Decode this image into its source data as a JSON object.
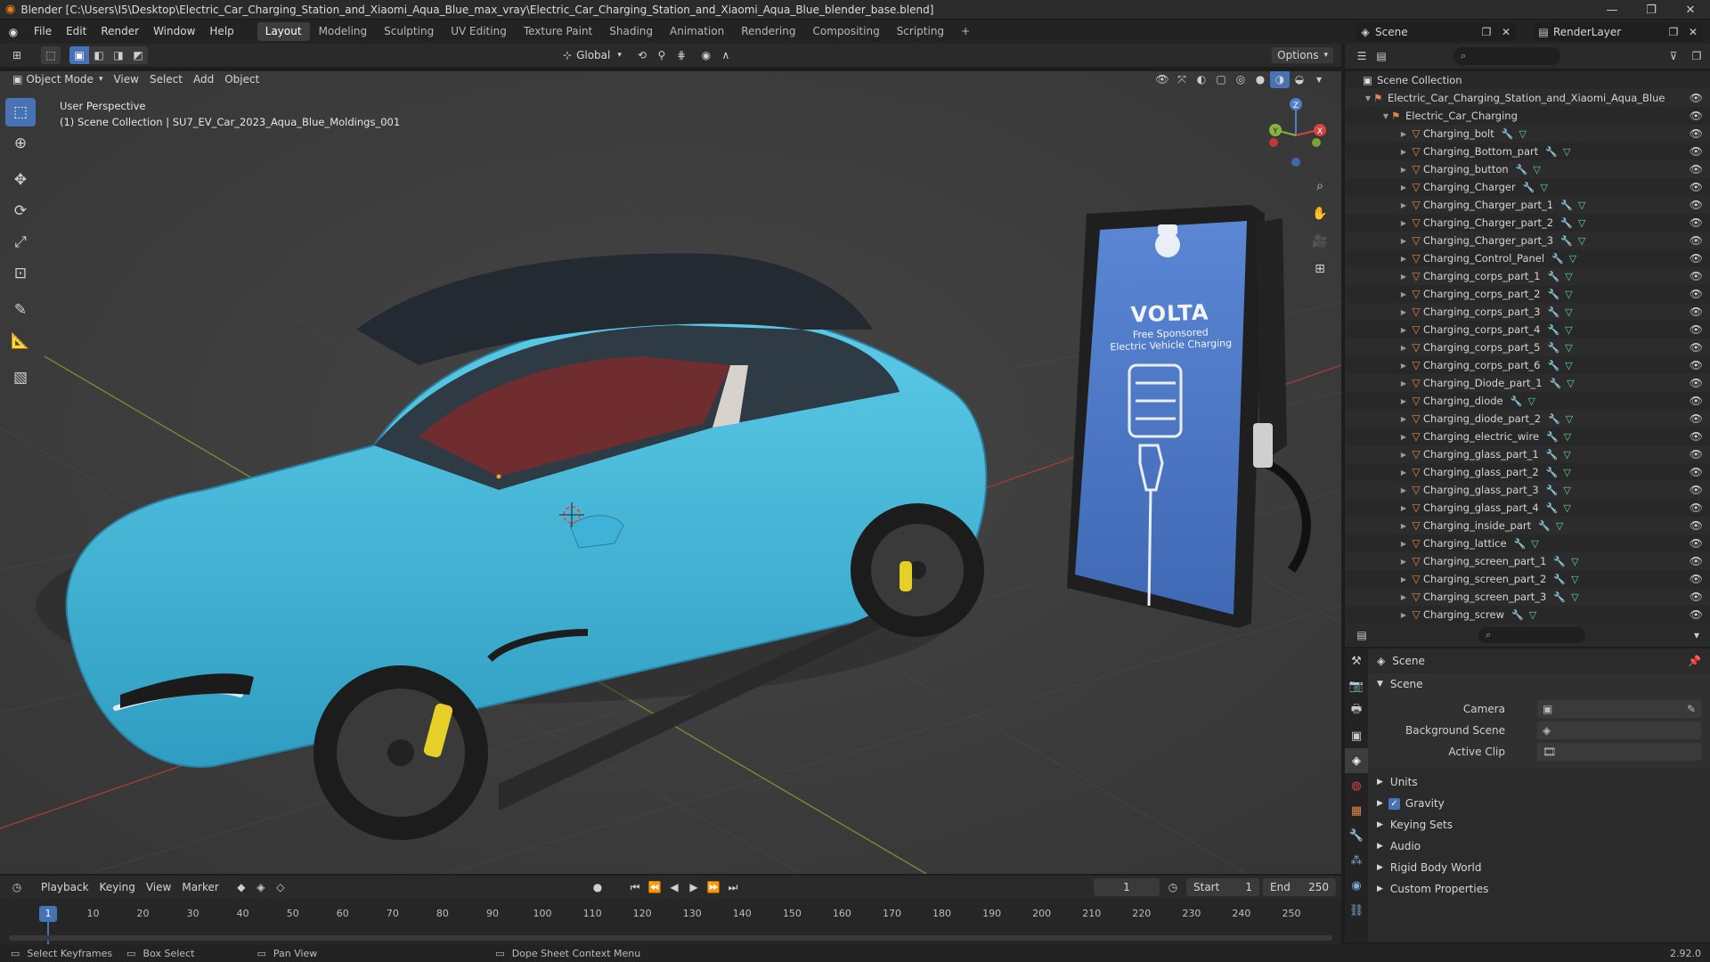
{
  "window": {
    "title": "Blender [C:\\Users\\I5\\Desktop\\Electric_Car_Charging_Station_and_Xiaomi_Aqua_Blue_max_vray\\Electric_Car_Charging_Station_and_Xiaomi_Aqua_Blue_blender_base.blend]"
  },
  "menu": [
    "File",
    "Edit",
    "Render",
    "Window",
    "Help"
  ],
  "workspaces": [
    "Layout",
    "Modeling",
    "Sculpting",
    "UV Editing",
    "Texture Paint",
    "Shading",
    "Animation",
    "Rendering",
    "Compositing",
    "Scripting"
  ],
  "active_workspace": "Layout",
  "scene_selector": "Scene",
  "renderlayer_selector": "RenderLayer",
  "viewport_header": {
    "mode": "Object Mode",
    "menus": [
      "View",
      "Select",
      "Add",
      "Object"
    ],
    "transform_orientation": "Global",
    "options": "Options"
  },
  "viewport": {
    "perspective": "User Perspective",
    "collection_info": "(1) Scene Collection | SU7_EV_Car_2023_Aqua_Blue_Moldings_001",
    "charger": {
      "brand": "VOLTA",
      "line1": "Free Sponsored",
      "line2": "Electric Vehicle Charging"
    },
    "gizmo": {
      "x": "X",
      "y": "Y",
      "z": "Z"
    }
  },
  "outliner": {
    "root": "Scene Collection",
    "collection": "Electric_Car_Charging_Station_and_Xiaomi_Aqua_Blue",
    "subcollection": "Electric_Car_Charging",
    "objects": [
      "Charging_bolt",
      "Charging_Bottom_part",
      "Charging_button",
      "Charging_Charger",
      "Charging_Charger_part_1",
      "Charging_Charger_part_2",
      "Charging_Charger_part_3",
      "Charging_Control_Panel",
      "Charging_corps_part_1",
      "Charging_corps_part_2",
      "Charging_corps_part_3",
      "Charging_corps_part_4",
      "Charging_corps_part_5",
      "Charging_corps_part_6",
      "Charging_Diode_part_1",
      "Charging_diode",
      "Charging_diode_part_2",
      "Charging_electric_wire",
      "Charging_glass_part_1",
      "Charging_glass_part_2",
      "Charging_glass_part_3",
      "Charging_glass_part_4",
      "Charging_inside_part",
      "Charging_lattice",
      "Charging_screen_part_1",
      "Charging_screen_part_2",
      "Charging_screen_part_3",
      "Charging_screw"
    ]
  },
  "properties": {
    "breadcrumb": "Scene",
    "panel": "Scene",
    "camera_label": "Camera",
    "background_label": "Background Scene",
    "clip_label": "Active Clip",
    "sections": [
      "Units",
      "Gravity",
      "Keying Sets",
      "Audio",
      "Rigid Body World",
      "Custom Properties"
    ],
    "gravity_checked": true
  },
  "timeline": {
    "menus": [
      "Playback",
      "Keying",
      "View",
      "Marker"
    ],
    "current_frame": "1",
    "start_label": "Start",
    "start": "1",
    "end_label": "End",
    "end": "250",
    "ticks": [
      "1",
      "10",
      "20",
      "30",
      "40",
      "50",
      "60",
      "70",
      "80",
      "90",
      "100",
      "110",
      "120",
      "130",
      "140",
      "150",
      "160",
      "170",
      "180",
      "190",
      "200",
      "210",
      "220",
      "230",
      "240",
      "250"
    ]
  },
  "statusbar": {
    "items": [
      "Select Keyframes",
      "Box Select",
      "Pan View",
      "Dope Sheet Context Menu"
    ],
    "version": "2.92.0"
  },
  "colors": {
    "accent": "#4772b3",
    "car_body": "#46bfe0",
    "charger_screen": "#4d79c9",
    "object_icon": "#e0884a",
    "mesh_icon": "#5dd6a3"
  }
}
